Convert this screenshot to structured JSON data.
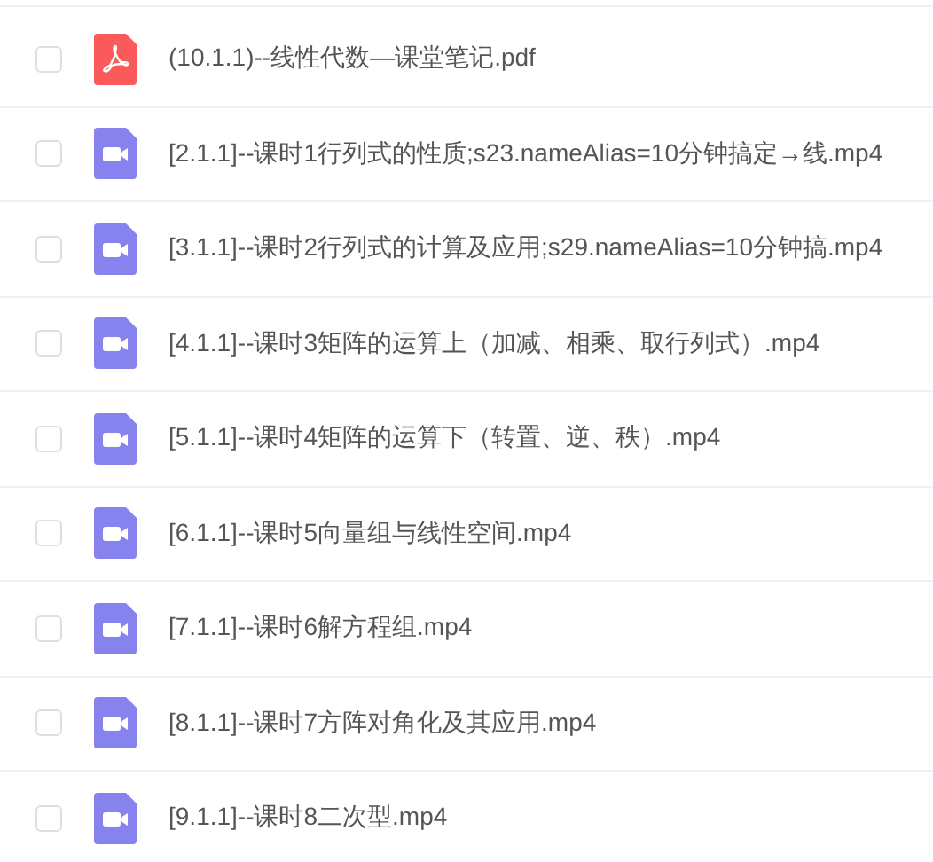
{
  "files": [
    {
      "kind": "pdf",
      "name": "(10.1.1)--线性代数—课堂笔记.pdf",
      "checked": false
    },
    {
      "kind": "video",
      "name": "[2.1.1]--课时1行列式的性质;s23.nameAlias=10分钟搞定→线.mp4",
      "checked": false
    },
    {
      "kind": "video",
      "name": "[3.1.1]--课时2行列式的计算及应用;s29.nameAlias=10分钟搞.mp4",
      "checked": false
    },
    {
      "kind": "video",
      "name": "[4.1.1]--课时3矩阵的运算上（加减、相乘、取行列式）.mp4",
      "checked": false
    },
    {
      "kind": "video",
      "name": "[5.1.1]--课时4矩阵的运算下（转置、逆、秩）.mp4",
      "checked": false
    },
    {
      "kind": "video",
      "name": "[6.1.1]--课时5向量组与线性空间.mp4",
      "checked": false
    },
    {
      "kind": "video",
      "name": "[7.1.1]--课时6解方程组.mp4",
      "checked": false
    },
    {
      "kind": "video",
      "name": "[8.1.1]--课时7方阵对角化及其应用.mp4",
      "checked": false
    },
    {
      "kind": "video",
      "name": "[9.1.1]--课时8二次型.mp4",
      "checked": false
    }
  ]
}
